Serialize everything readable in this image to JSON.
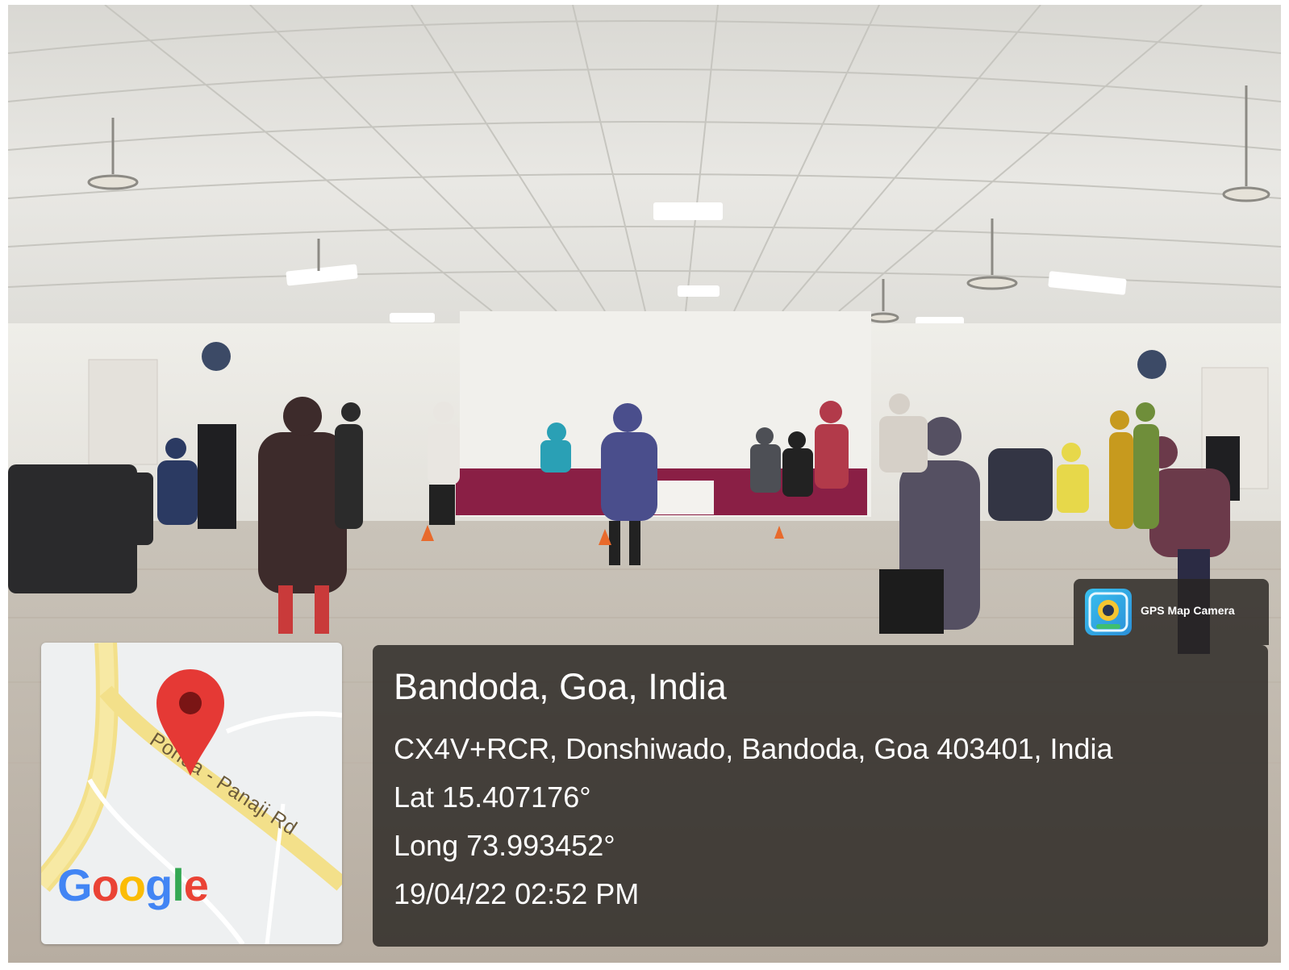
{
  "photo": {
    "description_icon": "dance-hall-photo"
  },
  "map": {
    "road_label": "Ponda - Panaji Rd",
    "logo_letters": [
      "G",
      "o",
      "o",
      "g",
      "l",
      "e"
    ],
    "logo_colors": [
      "#4285F4",
      "#EA4335",
      "#FBBC05",
      "#4285F4",
      "#34A853",
      "#EA4335"
    ],
    "pin_color": "#E53935"
  },
  "gps": {
    "place": "Bandoda, Goa, India",
    "address": "CX4V+RCR, Donshiwado, Bandoda, Goa 403401, India",
    "latitude": "Lat 15.407176°",
    "longitude": "Long 73.993452°",
    "datetime": "19/04/22 02:52 PM"
  },
  "badge": {
    "label": "GPS Map Camera",
    "icon": "gps-map-camera-icon"
  }
}
